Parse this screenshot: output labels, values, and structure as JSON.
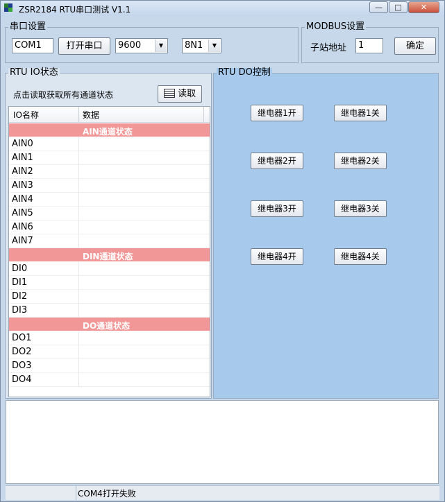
{
  "window": {
    "title": "ZSR2184 RTU串口测试 V1.1",
    "min": "—",
    "max": "□",
    "close": "✕"
  },
  "serial": {
    "label": "串口设置",
    "port": "COM1",
    "open_label": "打开串口",
    "baud": "9600",
    "format": "8N1"
  },
  "modbus": {
    "label": "MODBUS设置",
    "slave_label": "子站地址",
    "slave_value": "1",
    "confirm_label": "确定"
  },
  "io": {
    "label": "RTU IO状态",
    "hint": "点击读取获取所有通道状态",
    "read_label": "读取",
    "columns": [
      "IO名称",
      "数据"
    ],
    "rows": [
      {
        "type": "section",
        "name": "",
        "value": "AIN通道状态"
      },
      {
        "type": "item",
        "name": "AIN0",
        "value": ""
      },
      {
        "type": "item",
        "name": "AIN1",
        "value": ""
      },
      {
        "type": "item",
        "name": "AIN2",
        "value": ""
      },
      {
        "type": "item",
        "name": "AIN3",
        "value": ""
      },
      {
        "type": "item",
        "name": "AIN4",
        "value": ""
      },
      {
        "type": "item",
        "name": "AIN5",
        "value": ""
      },
      {
        "type": "item",
        "name": "AIN6",
        "value": ""
      },
      {
        "type": "item",
        "name": "AIN7",
        "value": ""
      },
      {
        "type": "section",
        "name": "",
        "value": "DIN通道状态"
      },
      {
        "type": "item",
        "name": "DI0",
        "value": ""
      },
      {
        "type": "item",
        "name": "DI1",
        "value": ""
      },
      {
        "type": "item",
        "name": "DI2",
        "value": ""
      },
      {
        "type": "item",
        "name": "DI3",
        "value": ""
      },
      {
        "type": "section",
        "name": "",
        "value": "DO通道状态"
      },
      {
        "type": "item",
        "name": "DO1",
        "value": ""
      },
      {
        "type": "item",
        "name": "DO2",
        "value": ""
      },
      {
        "type": "item",
        "name": "DO3",
        "value": ""
      },
      {
        "type": "item",
        "name": "DO4",
        "value": ""
      }
    ]
  },
  "do": {
    "label": "RTU DO控制",
    "buttons": [
      {
        "on": "继电器1开",
        "off": "继电器1关"
      },
      {
        "on": "继电器2开",
        "off": "继电器2关"
      },
      {
        "on": "继电器3开",
        "off": "继电器3关"
      },
      {
        "on": "继电器4开",
        "off": "继电器4关"
      }
    ]
  },
  "status": {
    "message": "COM4打开失败"
  }
}
